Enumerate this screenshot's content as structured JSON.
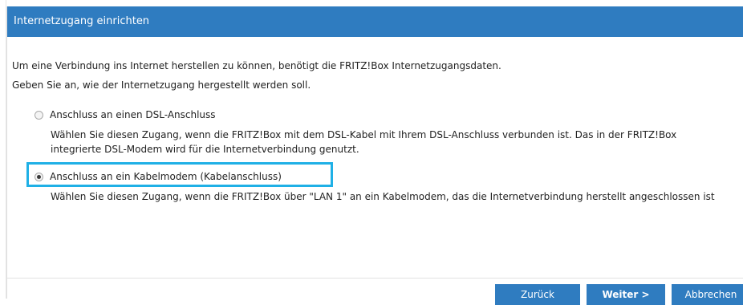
{
  "header": {
    "title": "Internetzugang einrichten"
  },
  "intro": {
    "line1": "Um eine Verbindung ins Internet herstellen zu können, benötigt die FRITZ!Box Internetzugangsdaten.",
    "line2": "Geben Sie an, wie der Internetzugang hergestellt werden soll."
  },
  "options": [
    {
      "label": "Anschluss an einen DSL-Anschluss",
      "description": "Wählen Sie diesen Zugang, wenn die FRITZ!Box mit dem DSL-Kabel mit Ihrem DSL-Anschluss verbunden ist. Das in der FRITZ!Box integrierte DSL-Modem wird für die Internetverbindung genutzt.",
      "checked": false
    },
    {
      "label": "Anschluss an ein Kabelmodem (Kabelanschluss)",
      "description": "Wählen Sie diesen Zugang, wenn die FRITZ!Box über \"LAN 1\" an ein Kabelmodem, das die Internetverbindung herstellt angeschlossen ist",
      "checked": true
    }
  ],
  "buttons": {
    "back": "Zurück",
    "next": "Weiter >",
    "cancel": "Abbrechen"
  },
  "colors": {
    "header": "#2f7cc0",
    "button": "#2f7cc0",
    "highlight": "#1fb0e6"
  }
}
